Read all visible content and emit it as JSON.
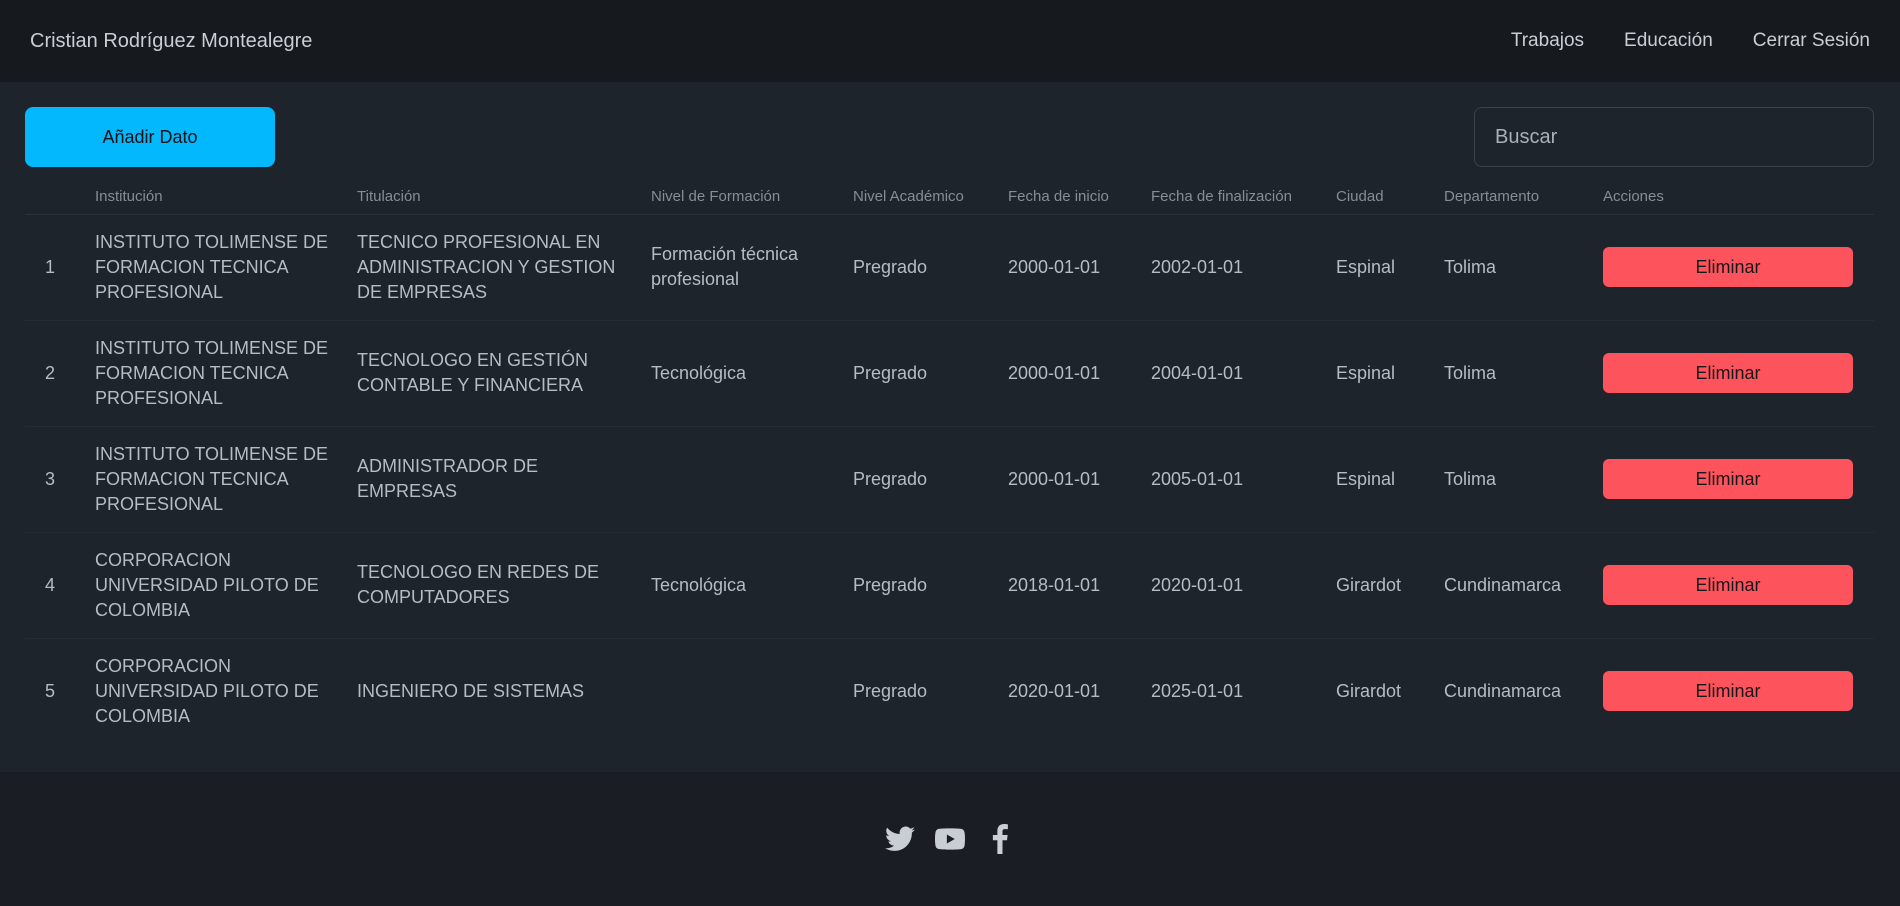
{
  "header": {
    "brand": "Cristian Rodríguez Montealegre",
    "nav": [
      "Trabajos",
      "Educación",
      "Cerrar Sesión"
    ]
  },
  "toolbar": {
    "add_label": "Añadir Dato",
    "search_placeholder": "Buscar"
  },
  "table": {
    "columns": [
      "",
      "Institución",
      "Titulación",
      "Nivel de Formación",
      "Nivel Académico",
      "Fecha de inicio",
      "Fecha de finalización",
      "Ciudad",
      "Departamento",
      "Acciones"
    ],
    "rows": [
      {
        "num": "1",
        "institucion": "INSTITUTO TOLIMENSE DE FORMACION TECNICA PROFESIONAL",
        "titulacion": "TECNICO PROFESIONAL EN ADMINISTRACION Y GESTION DE EMPRESAS",
        "nivel_formacion": "Formación técnica profesional",
        "nivel_academico": "Pregrado",
        "inicio": "2000-01-01",
        "fin": "2002-01-01",
        "ciudad": "Espinal",
        "departamento": "Tolima",
        "accion": "Eliminar"
      },
      {
        "num": "2",
        "institucion": "INSTITUTO TOLIMENSE DE FORMACION TECNICA PROFESIONAL",
        "titulacion": "TECNOLOGO EN GESTIÓN CONTABLE Y FINANCIERA",
        "nivel_formacion": "Tecnológica",
        "nivel_academico": "Pregrado",
        "inicio": "2000-01-01",
        "fin": "2004-01-01",
        "ciudad": "Espinal",
        "departamento": "Tolima",
        "accion": "Eliminar"
      },
      {
        "num": "3",
        "institucion": "INSTITUTO TOLIMENSE DE FORMACION TECNICA PROFESIONAL",
        "titulacion": "ADMINISTRADOR DE EMPRESAS",
        "nivel_formacion": "",
        "nivel_academico": "Pregrado",
        "inicio": "2000-01-01",
        "fin": "2005-01-01",
        "ciudad": "Espinal",
        "departamento": "Tolima",
        "accion": "Eliminar"
      },
      {
        "num": "4",
        "institucion": "CORPORACION UNIVERSIDAD PILOTO DE COLOMBIA",
        "titulacion": "TECNOLOGO EN REDES DE COMPUTADORES",
        "nivel_formacion": "Tecnológica",
        "nivel_academico": "Pregrado",
        "inicio": "2018-01-01",
        "fin": "2020-01-01",
        "ciudad": "Girardot",
        "departamento": "Cundinamarca",
        "accion": "Eliminar"
      },
      {
        "num": "5",
        "institucion": "CORPORACION UNIVERSIDAD PILOTO DE COLOMBIA",
        "titulacion": "INGENIERO DE SISTEMAS",
        "nivel_formacion": "",
        "nivel_academico": "Pregrado",
        "inicio": "2020-01-01",
        "fin": "2025-01-01",
        "ciudad": "Girardot",
        "departamento": "Cundinamarca",
        "accion": "Eliminar"
      }
    ]
  },
  "footer": {
    "icons": [
      "twitter-icon",
      "youtube-icon",
      "facebook-icon"
    ]
  },
  "colors": {
    "accent": "#03b8fc",
    "danger": "#fd535c",
    "navbar_bg": "#161a1f",
    "content_bg": "#1e242c",
    "footer_bg": "#1a1e24"
  }
}
